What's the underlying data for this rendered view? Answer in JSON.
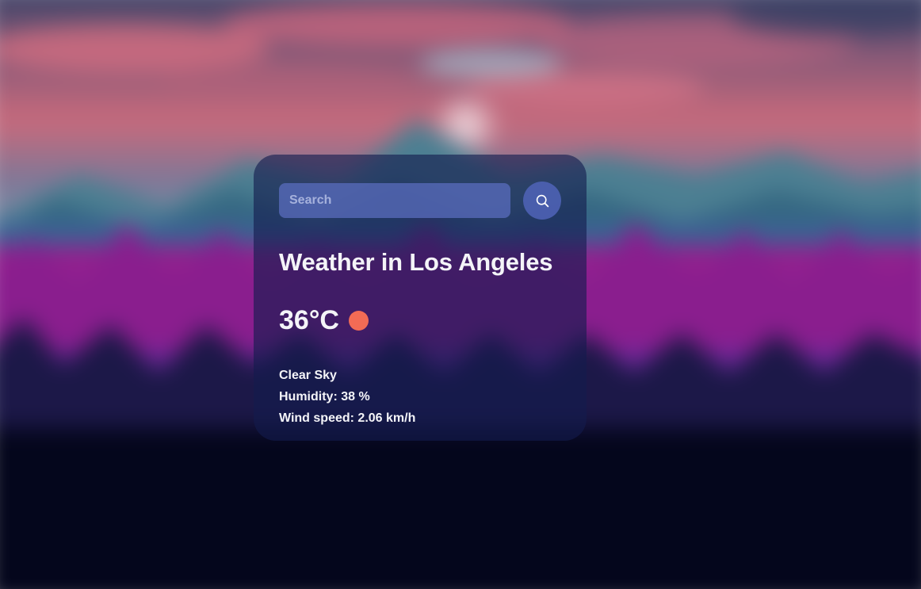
{
  "colors": {
    "sun_icon": "#f26b55",
    "card_bg": "#141c4e",
    "search_bg": "#5a6cbe",
    "button_bg": "#4e62b4"
  },
  "search": {
    "placeholder": "Search",
    "value": "",
    "button_icon": "search-icon"
  },
  "weather": {
    "title": "Weather in Los Angeles",
    "temperature": "36°C",
    "icon": "sun-icon",
    "description": "Clear Sky",
    "humidity_label": "Humidity:",
    "humidity_value": "38 %",
    "wind_label": "Wind speed:",
    "wind_value": "2.06 km/h"
  }
}
